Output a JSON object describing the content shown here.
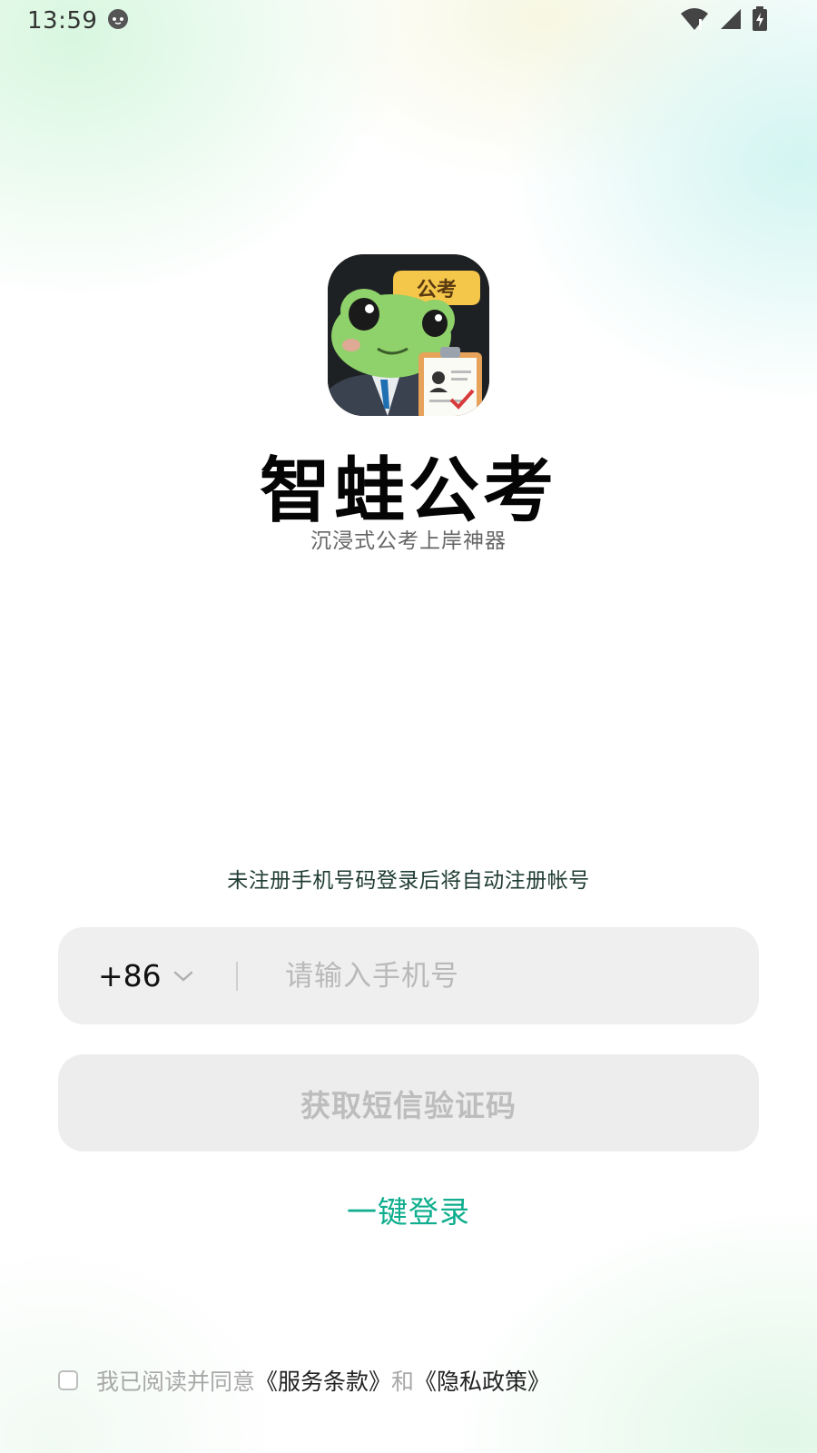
{
  "status_bar": {
    "time": "13:59",
    "icons": [
      "cat-notification-icon",
      "wifi-icon",
      "signal-icon",
      "battery-charging-icon"
    ]
  },
  "app": {
    "title": "智蛙公考",
    "subtitle": "沉浸式公考上岸神器",
    "icon_badge_text": "公考"
  },
  "login": {
    "hint": "未注册手机号码登录后将自动注册帐号",
    "country_code": "+86",
    "phone_placeholder": "请输入手机号",
    "phone_value": "",
    "sms_button_label": "获取短信验证码",
    "one_key_login_label": "一键登录"
  },
  "agreement": {
    "checked": false,
    "prefix": "我已阅读并同意",
    "terms_link": "《服务条款》",
    "connector": "和",
    "privacy_link": "《隐私政策》"
  },
  "colors": {
    "accent": "#0fae8e",
    "hint_text": "#1f3b33",
    "input_bg": "#efefef",
    "disabled_text": "#bdbdbd"
  }
}
